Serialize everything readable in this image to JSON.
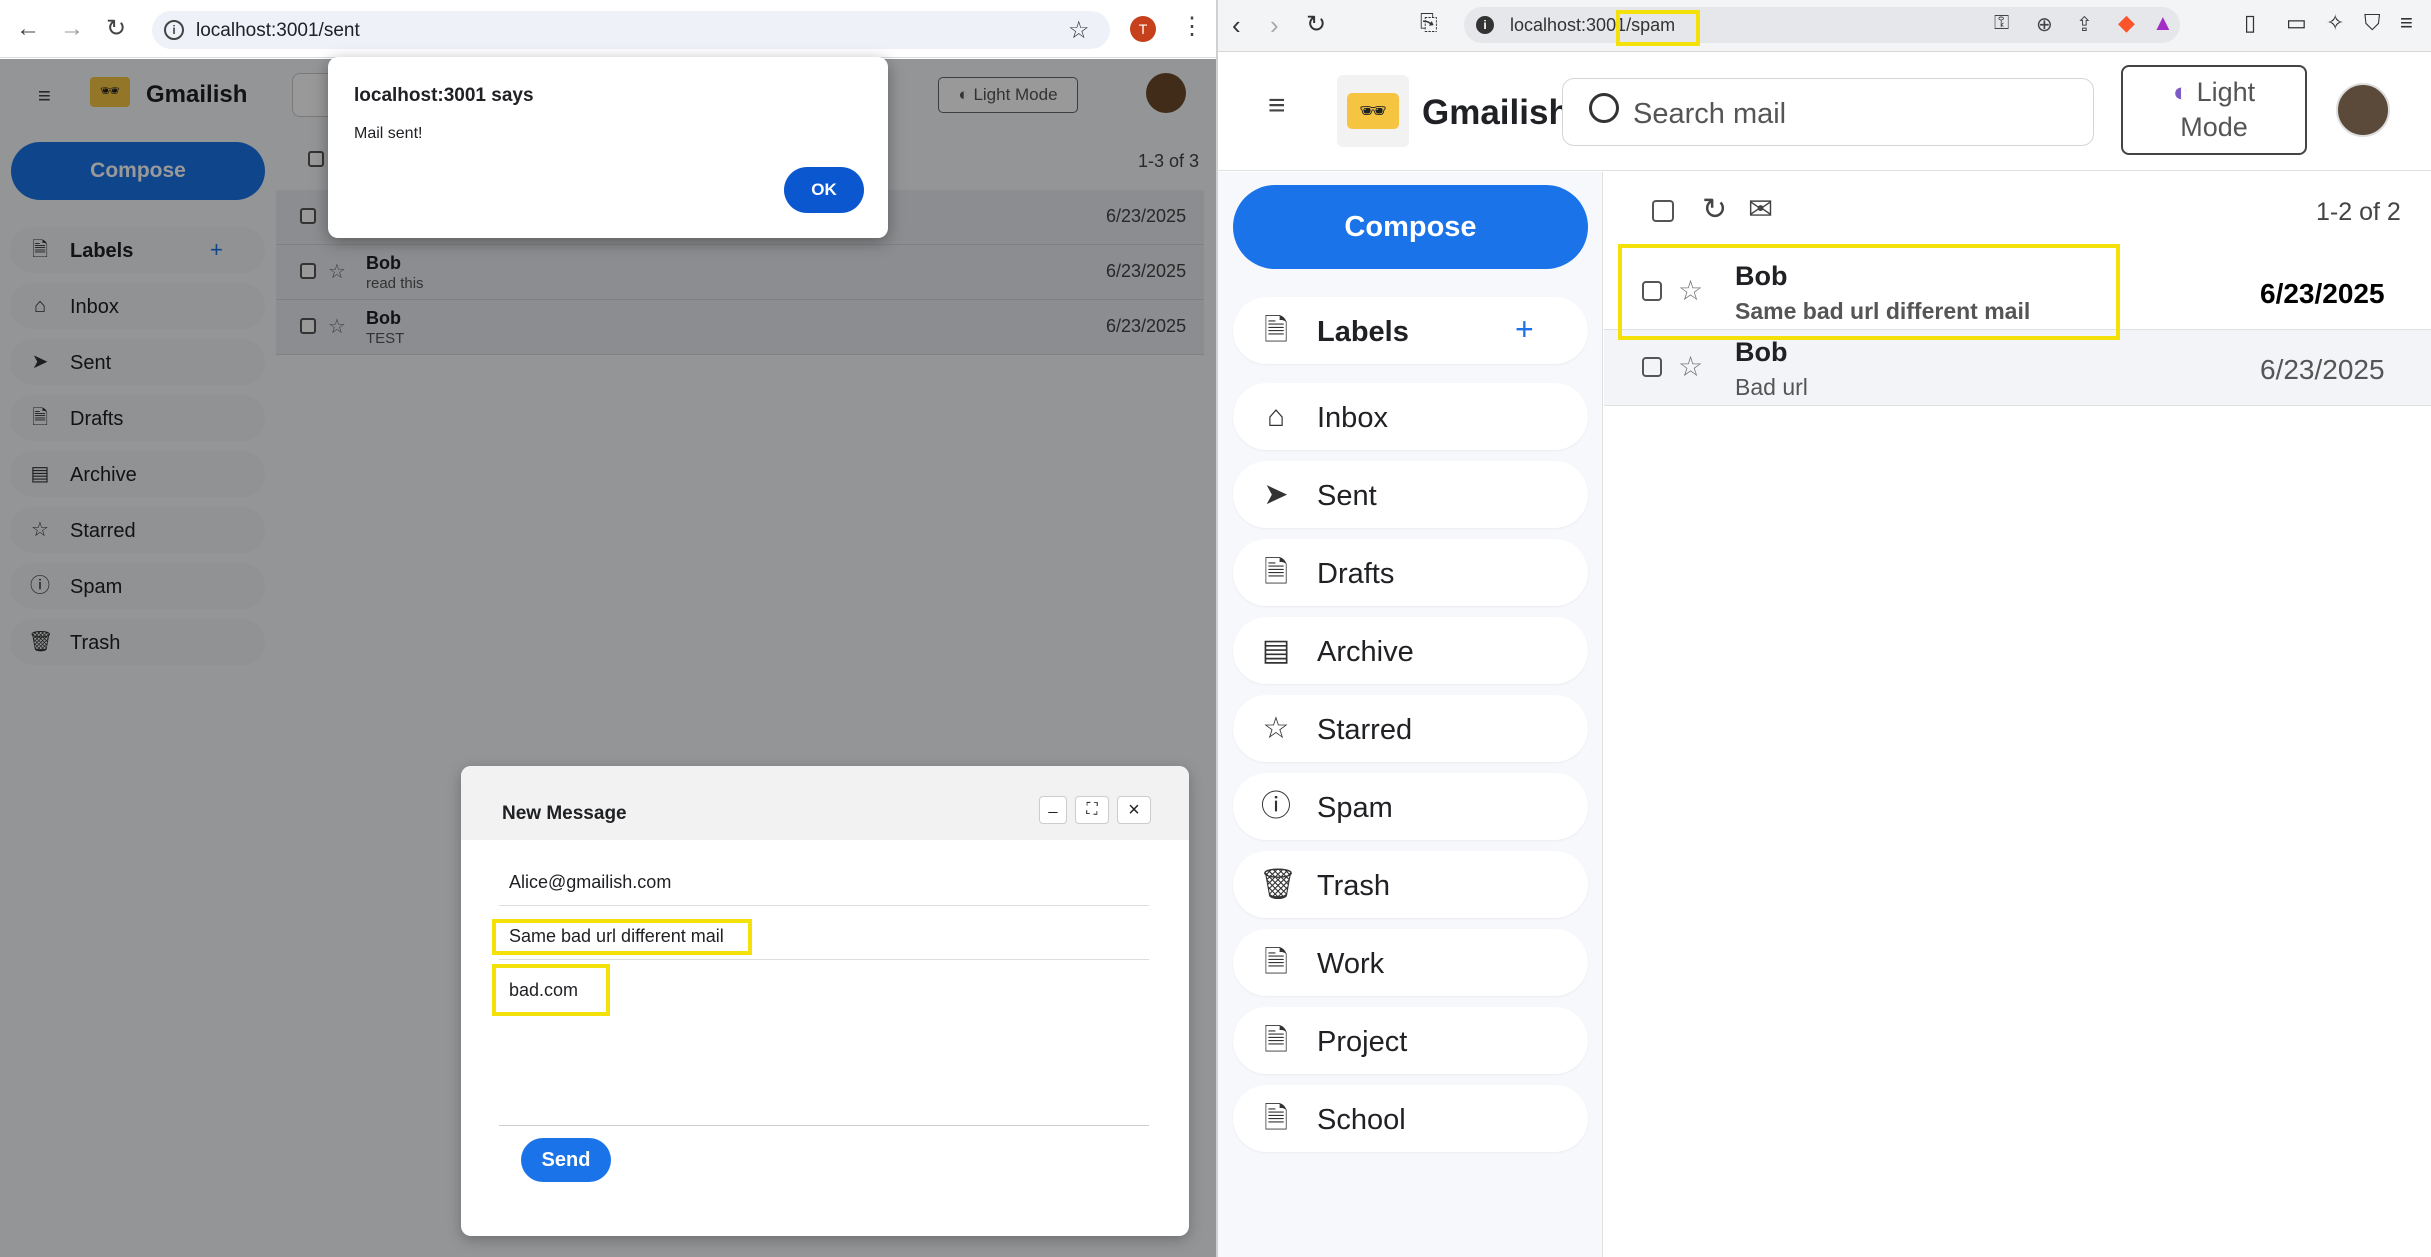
{
  "left_browser": {
    "url": "localhost:3001/sent",
    "profile_initial": "T",
    "app": {
      "name": "Gmailish",
      "compose_label": "Compose",
      "theme_label": "Light Mode",
      "labels_title": "Labels",
      "add_label": "+",
      "nav": [
        {
          "label": "Inbox",
          "icon": "inbox-icon"
        },
        {
          "label": "Sent",
          "icon": "send-icon"
        },
        {
          "label": "Drafts",
          "icon": "document-icon"
        },
        {
          "label": "Archive",
          "icon": "archive-icon"
        },
        {
          "label": "Starred",
          "icon": "star-icon"
        },
        {
          "label": "Spam",
          "icon": "warning-icon"
        },
        {
          "label": "Trash",
          "icon": "trash-icon"
        }
      ],
      "pagination": "1-3 of 3",
      "emails": [
        {
          "sender": "",
          "subject": "",
          "date": "6/23/2025"
        },
        {
          "sender": "Bob",
          "subject": "read this",
          "date": "6/23/2025"
        },
        {
          "sender": "Bob",
          "subject": "TEST",
          "date": "6/23/2025"
        }
      ]
    },
    "dialog": {
      "title": "localhost:3001 says",
      "message": "Mail sent!",
      "ok_label": "OK"
    },
    "compose": {
      "title": "New Message",
      "minimize": "_",
      "expand": "⛶",
      "close": "×",
      "to": "Alice@gmailish.com",
      "subject": "Same bad url different mail",
      "body": "bad.com",
      "send_label": "Send"
    }
  },
  "right_browser": {
    "url_host": "localhost:3001",
    "url_path": "/spam",
    "app": {
      "name": "Gmailish",
      "search_placeholder": "Search mail",
      "theme_label_1": "Light",
      "theme_label_2": "Mode",
      "compose_label": "Compose",
      "labels_title": "Labels",
      "add_label": "+",
      "nav": [
        {
          "label": "Inbox",
          "icon": "inbox-icon"
        },
        {
          "label": "Sent",
          "icon": "send-icon"
        },
        {
          "label": "Drafts",
          "icon": "document-icon"
        },
        {
          "label": "Archive",
          "icon": "archive-icon"
        },
        {
          "label": "Starred",
          "icon": "star-icon"
        },
        {
          "label": "Spam",
          "icon": "warning-icon"
        },
        {
          "label": "Trash",
          "icon": "trash-icon"
        },
        {
          "label": "Work",
          "icon": "document-icon"
        },
        {
          "label": "Project",
          "icon": "document-icon"
        },
        {
          "label": "School",
          "icon": "document-icon"
        }
      ],
      "pagination": "1-2 of 2",
      "emails": [
        {
          "sender": "Bob",
          "subject": "Same bad url different mail",
          "date": "6/23/2025",
          "unread": true
        },
        {
          "sender": "Bob",
          "subject": "Bad url",
          "date": "6/23/2025",
          "unread": false
        }
      ]
    }
  },
  "colors": {
    "accent": "#1a73e8",
    "highlight": "#f5e10a",
    "dialog_button": "#0b57d0"
  }
}
